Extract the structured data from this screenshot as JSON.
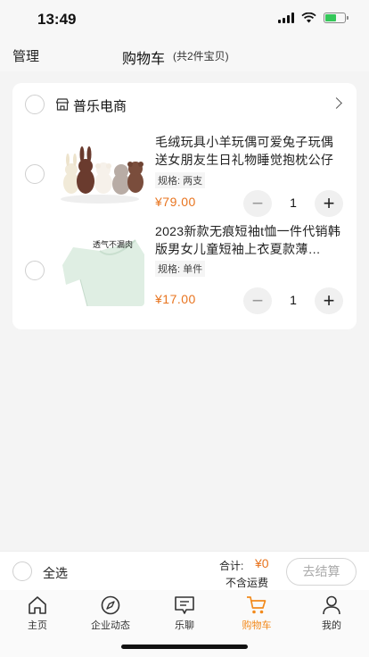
{
  "status_bar": {
    "time": "13:49"
  },
  "header": {
    "manage_label": "管理",
    "title": "购物车",
    "count_text": "(共2件宝贝)"
  },
  "shop": {
    "name": "普乐电商",
    "icon": "store-icon"
  },
  "items": [
    {
      "title": "毛绒玩具小羊玩偶可爱兔子玩偶送女朋友生日礼物睡觉抱枕公仔",
      "spec": "规格: 两支",
      "price": "¥79.00",
      "quantity": "1"
    },
    {
      "title": "2023新款无痕短袖t恤一件代销韩版男女儿童短袖上衣夏款薄…",
      "spec": "规格: 单件",
      "price": "¥17.00",
      "quantity": "1",
      "thumb_caption": "透气不漏肉"
    }
  ],
  "stepper": {
    "minus": "−",
    "plus": "+"
  },
  "checkout": {
    "select_all": "全选",
    "total_label": "合计:",
    "total_value": "¥0",
    "shipping_note": "不含运费",
    "checkout_button": "去结算"
  },
  "tabs": [
    {
      "label": "主页",
      "icon": "home-icon"
    },
    {
      "label": "企业动态",
      "icon": "compass-icon"
    },
    {
      "label": "乐聊",
      "icon": "chat-icon"
    },
    {
      "label": "购物车",
      "icon": "cart-icon",
      "active": true
    },
    {
      "label": "我的",
      "icon": "user-icon"
    }
  ],
  "colors": {
    "accent": "#e8741f",
    "tab_active": "#f28a1c",
    "background": "#f4f4f4"
  }
}
